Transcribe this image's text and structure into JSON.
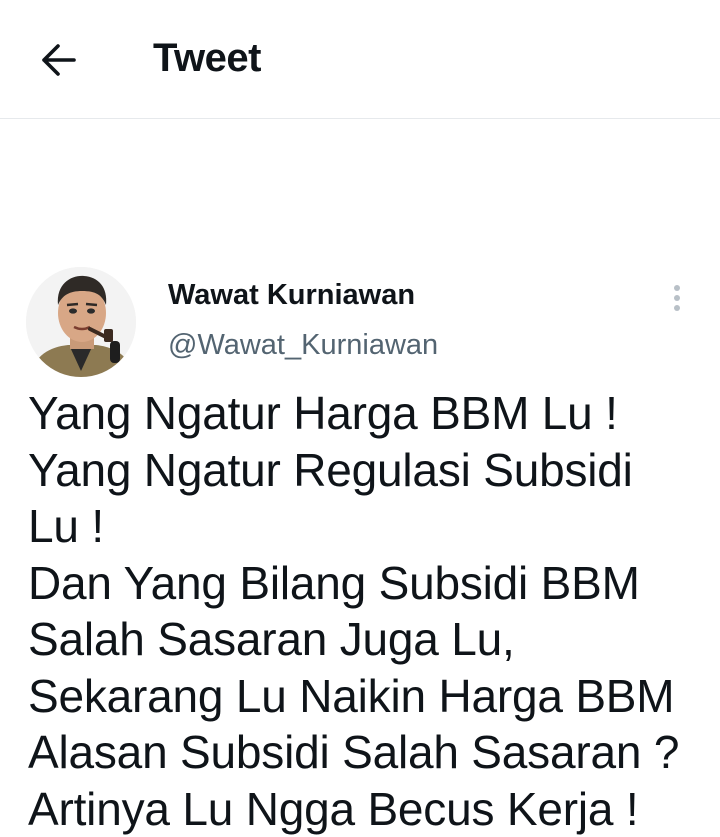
{
  "header": {
    "title": "Tweet",
    "back_icon": "arrow-left-icon"
  },
  "tweet": {
    "author": {
      "display_name": "Wawat Kurniawan",
      "handle": "@Wawat_Kurniawan",
      "avatar_icon": "avatar-caricature"
    },
    "more_icon": "more-vertical-icon",
    "lines": [
      "Yang Ngatur Harga BBM Lu !",
      "Yang Ngatur Regulasi Subsidi",
      "Lu !",
      "Dan Yang Bilang Subsidi BBM",
      "Salah Sasaran Juga Lu,",
      "Sekarang Lu Naikin Harga BBM",
      "Alasan Subsidi Salah Sasaran ?",
      "Artinya Lu Ngga Becus Kerja !"
    ]
  },
  "colors": {
    "text": "#0f1419",
    "secondary": "#536471",
    "divider": "#e6e9ec"
  }
}
